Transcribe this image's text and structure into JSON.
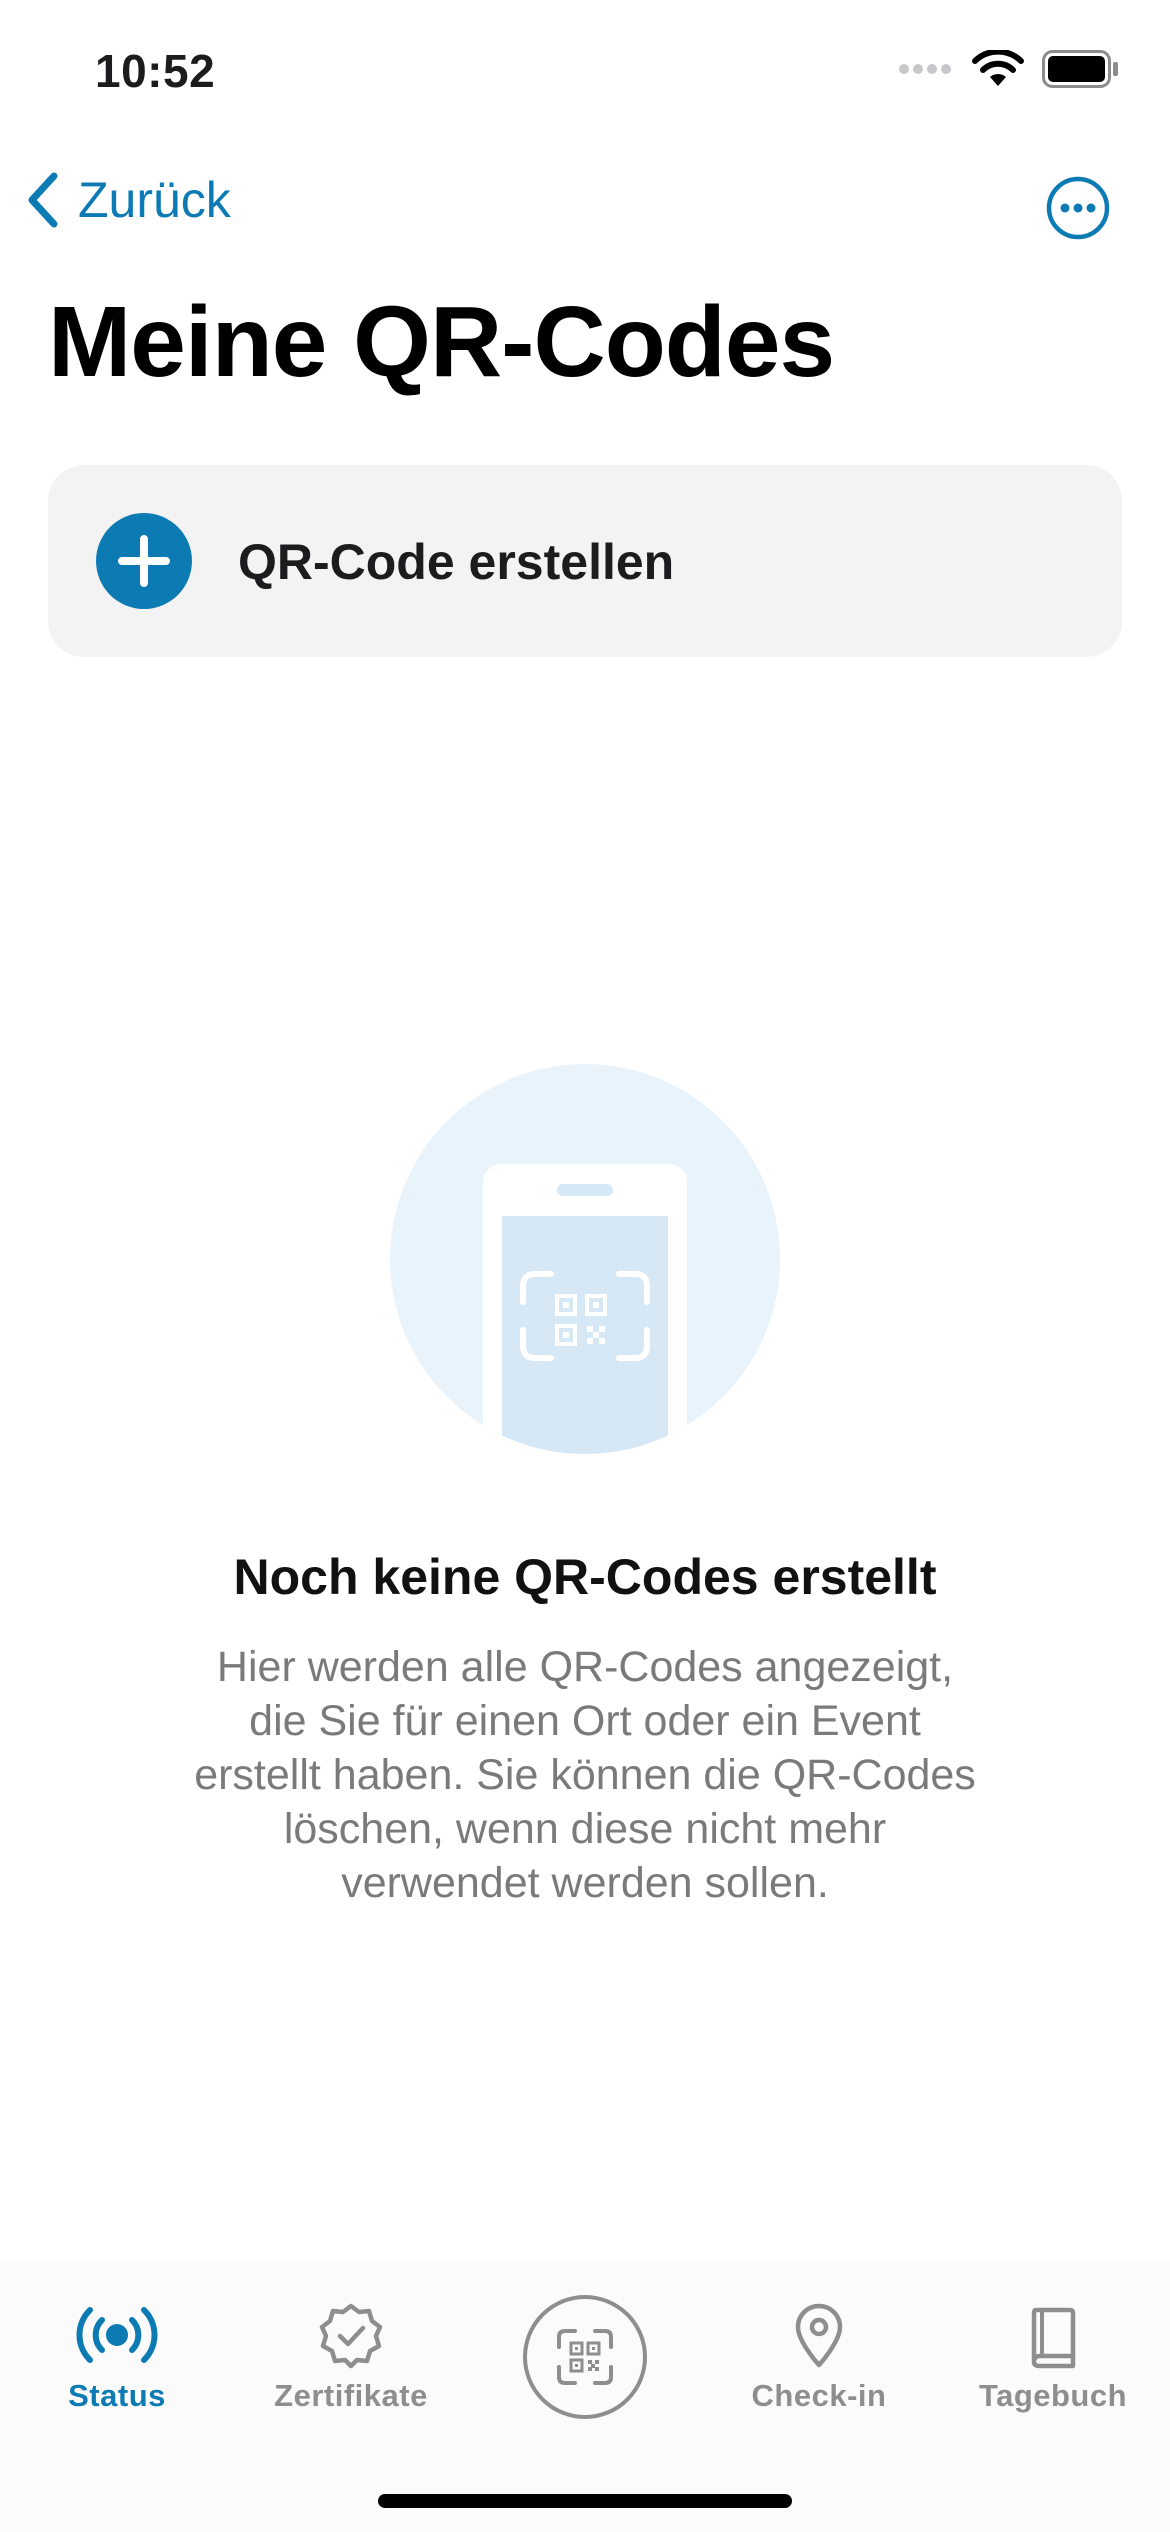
{
  "status_bar": {
    "time": "10:52"
  },
  "nav": {
    "back_label": "Zurück"
  },
  "page": {
    "title": "Meine QR-Codes"
  },
  "create": {
    "label": "QR-Code erstellen"
  },
  "empty_state": {
    "title": "Noch keine QR-Codes erstellt",
    "description_lines": [
      "Hier werden alle QR-Codes angezeigt,",
      "die Sie für einen Ort oder ein Event",
      "erstellt haben. Sie können die QR-Codes",
      "löschen, wenn diese nicht mehr",
      "verwendet werden sollen."
    ]
  },
  "tab_bar": {
    "tabs": [
      {
        "label": "Status",
        "icon": "broadcast-icon",
        "active": true
      },
      {
        "label": "Zertifikate",
        "icon": "certificate-badge-icon",
        "active": false
      },
      {
        "label": "",
        "icon": "qr-scan-icon",
        "active": false
      },
      {
        "label": "Check-in",
        "icon": "location-pin-icon",
        "active": false
      },
      {
        "label": "Tagebuch",
        "icon": "book-icon",
        "active": false
      }
    ]
  },
  "colors": {
    "accent": "#0c7bb4",
    "inactive": "#8e8e8e",
    "card": "#f3f3f3",
    "illustration_bg": "#e8f3fc"
  }
}
